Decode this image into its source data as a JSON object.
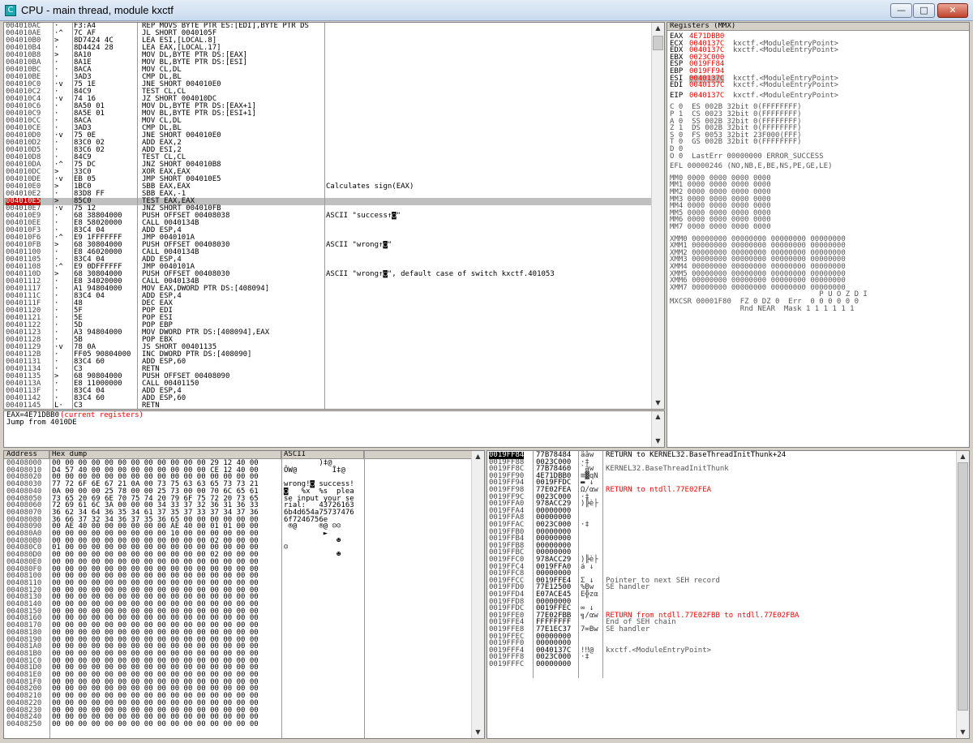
{
  "window": {
    "title": "CPU - main thread, module kxctf",
    "icon_letter": "C",
    "min": "—",
    "max": "□",
    "close": "✕"
  },
  "disasm": {
    "rows": [
      [
        "004010AC",
        "·",
        "F3:A4",
        "REP MOVS BYTE PTR ES:[EDI],BYTE PTR DS",
        ""
      ],
      [
        "004010AE",
        "·^",
        "7C AF",
        "JL SHORT 0040105F",
        ""
      ],
      [
        "004010B0",
        ">",
        "8D7424 4C",
        "LEA ESI,[LOCAL.8]",
        ""
      ],
      [
        "004010B4",
        "·",
        "8D4424 28",
        "LEA EAX,[LOCAL.17]",
        ""
      ],
      [
        "004010B8",
        ">",
        "8A10",
        "MOV DL,BYTE PTR DS:[EAX]",
        ""
      ],
      [
        "004010BA",
        "·",
        "8A1E",
        "MOV BL,BYTE PTR DS:[ESI]",
        ""
      ],
      [
        "004010BC",
        "·",
        "8ACA",
        "MOV CL,DL",
        ""
      ],
      [
        "004010BE",
        "·",
        "3AD3",
        "CMP DL,BL",
        ""
      ],
      [
        "004010C0",
        "·v",
        "75 1E",
        "JNE SHORT 004010E0",
        ""
      ],
      [
        "004010C2",
        "·",
        "84C9",
        "TEST CL,CL",
        ""
      ],
      [
        "004010C4",
        "·v",
        "74 16",
        "JZ SHORT 004010DC",
        ""
      ],
      [
        "004010C6",
        "·",
        "8A50 01",
        "MOV DL,BYTE PTR DS:[EAX+1]",
        ""
      ],
      [
        "004010C9",
        "·",
        "8A5E 01",
        "MOV BL,BYTE PTR DS:[ESI+1]",
        ""
      ],
      [
        "004010CC",
        "·",
        "8ACA",
        "MOV CL,DL",
        ""
      ],
      [
        "004010CE",
        "·",
        "3AD3",
        "CMP DL,BL",
        ""
      ],
      [
        "004010D0",
        "·v",
        "75 0E",
        "JNE SHORT 004010E0",
        ""
      ],
      [
        "004010D2",
        "·",
        "83C0 02",
        "ADD EAX,2",
        ""
      ],
      [
        "004010D5",
        "·",
        "83C6 02",
        "ADD ESI,2",
        ""
      ],
      [
        "004010D8",
        "·",
        "84C9",
        "TEST CL,CL",
        ""
      ],
      [
        "004010DA",
        "·^",
        "75 DC",
        "JNZ SHORT 004010B8",
        ""
      ],
      [
        "004010DC",
        ">",
        "33C0",
        "XOR EAX,EAX",
        ""
      ],
      [
        "004010DE",
        "·v",
        "EB 05",
        "JMP SHORT 004010E5",
        ""
      ],
      [
        "004010E0",
        ">",
        "1BC0",
        "SBB EAX,EAX",
        "Calculates sign(EAX)"
      ],
      [
        "004010E2",
        "·",
        "83D8 FF",
        "SBB EAX,-1",
        ""
      ],
      [
        "004010E5",
        ">",
        "85C0",
        "TEST EAX,EAX",
        ""
      ],
      [
        "004010E7",
        "·v",
        "75 12",
        "JNZ SHORT 004010FB",
        ""
      ],
      [
        "004010E9",
        "·",
        "68 38804000",
        "PUSH OFFSET 00408038",
        "ASCII \"success↑◙\""
      ],
      [
        "004010EE",
        "·",
        "E8 58020000",
        "CALL 0040134B",
        ""
      ],
      [
        "004010F3",
        "·",
        "83C4 04",
        "ADD ESP,4",
        ""
      ],
      [
        "004010F6",
        "·^",
        "E9 1FFFFFFF",
        "JMP 0040101A",
        ""
      ],
      [
        "004010FB",
        ">",
        "68 30804000",
        "PUSH OFFSET 00408030",
        "ASCII \"wrong↑◙\""
      ],
      [
        "00401100",
        "·",
        "E8 46020000",
        "CALL 0040134B",
        ""
      ],
      [
        "00401105",
        "·",
        "83C4 04",
        "ADD ESP,4",
        ""
      ],
      [
        "00401108",
        "·^",
        "E9 0DFFFFFF",
        "JMP 0040101A",
        ""
      ],
      [
        "0040110D",
        ">",
        "68 30804000",
        "PUSH OFFSET 00408030",
        "ASCII \"wrong↑◙\", default case of switch kxctf.401053"
      ],
      [
        "00401112",
        "·",
        "E8 34020000",
        "CALL 0040134B",
        ""
      ],
      [
        "00401117",
        "·",
        "A1 94804000",
        "MOV EAX,DWORD PTR DS:[408094]",
        ""
      ],
      [
        "0040111C",
        "·",
        "83C4 04",
        "ADD ESP,4",
        ""
      ],
      [
        "0040111F",
        "·",
        "48",
        "DEC EAX",
        ""
      ],
      [
        "00401120",
        "·",
        "5F",
        "POP EDI",
        ""
      ],
      [
        "00401121",
        "·",
        "5E",
        "POP ESI",
        ""
      ],
      [
        "00401122",
        "·",
        "5D",
        "POP EBP",
        ""
      ],
      [
        "00401123",
        "·",
        "A3 94804000",
        "MOV DWORD PTR DS:[408094],EAX",
        ""
      ],
      [
        "00401128",
        "·",
        "5B",
        "POP EBX",
        ""
      ],
      [
        "00401129",
        "·v",
        "78 0A",
        "JS SHORT 00401135",
        ""
      ],
      [
        "0040112B",
        "·",
        "FF05 90804000",
        "INC DWORD PTR DS:[408090]",
        ""
      ],
      [
        "00401131",
        "·",
        "83C4 60",
        "ADD ESP,60",
        ""
      ],
      [
        "00401134",
        "·",
        "C3",
        "RETN",
        ""
      ],
      [
        "00401135",
        ">",
        "68 90804000",
        "PUSH OFFSET 00408090",
        ""
      ],
      [
        "0040113A",
        "·",
        "E8 11000000",
        "CALL 00401150",
        ""
      ],
      [
        "0040113F",
        "·",
        "83C4 04",
        "ADD ESP,4",
        ""
      ],
      [
        "00401142",
        "·",
        "83C4 60",
        "ADD ESP,60",
        ""
      ],
      [
        "00401145",
        "L·",
        "C3",
        "RETN",
        ""
      ]
    ],
    "current_index": 24,
    "info_line1": "EAX=4E71DBB0",
    "info_line1_note": "(current registers)",
    "info_line2": "Jump from 4010DE"
  },
  "registers": {
    "title": "Registers (MMX)",
    "lines": [
      [
        "EAX",
        "4E71DBB0",
        ""
      ],
      [
        "ECX",
        "0040137C",
        "kxctf.<ModuleEntryPoint>"
      ],
      [
        "EDX",
        "0040137C",
        "kxctf.<ModuleEntryPoint>"
      ],
      [
        "EBX",
        "0023C000",
        ""
      ],
      [
        "ESP",
        "0019FF84",
        ""
      ],
      [
        "EBP",
        "0019FF94",
        ""
      ],
      [
        "ESI",
        "0040137C",
        "kxctf.<ModuleEntryPoint>"
      ],
      [
        "EDI",
        "0040137C",
        "kxctf.<ModuleEntryPoint>"
      ]
    ],
    "eip": [
      "EIP",
      "0040137C",
      "kxctf.<ModuleEntryPoint>"
    ],
    "flags": [
      "C 0  ES 002B 32bit 0(FFFFFFFF)",
      "P 1  CS 0023 32bit 0(FFFFFFFF)",
      "A 0  SS 002B 32bit 0(FFFFFFFF)",
      "Z 1  DS 002B 32bit 0(FFFFFFFF)",
      "S 0  FS 0053 32bit 23F000(FFF)",
      "T 0  GS 002B 32bit 0(FFFFFFFF)",
      "D 0",
      "O 0  LastErr 00000000 ERROR_SUCCESS"
    ],
    "efl": "EFL 00000246 (NO,NB,E,BE,NS,PE,GE,LE)",
    "mm": [
      "MM0 0000 0000 0000 0000",
      "MM1 0000 0000 0000 0000",
      "MM2 0000 0000 0000 0000",
      "MM3 0000 0000 0000 0000",
      "MM4 0000 0000 0000 0000",
      "MM5 0000 0000 0000 0000",
      "MM6 0000 0000 0000 0000",
      "MM7 0000 0000 0000 0000"
    ],
    "xmm": [
      "XMM0 00000000 00000000 00000000 00000000",
      "XMM1 00000000 00000000 00000000 00000000",
      "XMM2 00000000 00000000 00000000 00000000",
      "XMM3 00000000 00000000 00000000 00000000",
      "XMM4 00000000 00000000 00000000 00000000",
      "XMM5 00000000 00000000 00000000 00000000",
      "XMM6 00000000 00000000 00000000 00000000",
      "XMM7 00000000 00000000 00000000 00000000"
    ],
    "mxcsr_hdr": "                                  P U O Z D I",
    "mxcsr": "MXCSR 00001F80  FZ 0 DZ 0  Err  0 0 0 0 0 0",
    "mxcsr2": "                Rnd NEAR  Mask 1 1 1 1 1 1"
  },
  "dump": {
    "headers": [
      "Address",
      "Hex dump",
      "ASCII"
    ],
    "rows": [
      [
        "00408000",
        "00 00 00 00 00 00 00 00 00 00 00 00 29 12 40 00",
        "        )‡@"
      ],
      [
        "00408010",
        "D4 57 40 00 00 00 00 00 00 00 00 00 CE 12 40 00",
        "ÔW@        Î‡@"
      ],
      [
        "00408020",
        "00 00 00 00 00 00 00 00 00 00 00 00 00 00 00 00",
        ""
      ],
      [
        "00408030",
        "77 72 6F 6E 67 21 0A 00 73 75 63 63 65 73 73 21",
        "wrong!◙ success!"
      ],
      [
        "00408040",
        "0A 00 00 00 25 78 00 00 25 73 00 00 70 6C 65 61",
        "◙   %x  %s  plea"
      ],
      [
        "00408050",
        "73 65 20 69 6E 70 75 74 20 79 6F 75 72 20 73 65",
        "se input your se"
      ],
      [
        "00408060",
        "72 69 61 6C 3A 00 00 00 34 33 37 32 36 31 36 33",
        "rial:   43726163"
      ],
      [
        "00408070",
        "36 62 34 64 36 35 34 61 37 35 37 33 37 34 37 36",
        "6b4d654a75737476"
      ],
      [
        "00408080",
        "36 66 37 32 34 36 37 35 36 65 00 00 00 00 00 00",
        "6f7246756e"
      ],
      [
        "00408090",
        "00 AE 40 00 00 00 00 00 00 AE 40 00 01 01 00 00",
        " ®@     ®@ ☺☺"
      ],
      [
        "004080A0",
        "00 00 00 00 00 00 00 00 00 10 00 00 00 00 00 00",
        "         ►"
      ],
      [
        "004080B0",
        "00 00 00 00 00 00 00 00 00 00 00 00 02 00 00 00",
        "            ☻"
      ],
      [
        "004080C0",
        "01 00 00 00 00 00 00 00 00 00 00 00 00 00 00 00",
        "☺"
      ],
      [
        "004080D0",
        "00 00 00 00 00 00 00 00 00 00 00 00 02 00 00 00",
        "            ☻"
      ],
      [
        "004080E0",
        "00 00 00 00 00 00 00 00 00 00 00 00 00 00 00 00",
        ""
      ],
      [
        "004080F0",
        "00 00 00 00 00 00 00 00 00 00 00 00 00 00 00 00",
        ""
      ],
      [
        "00408100",
        "00 00 00 00 00 00 00 00 00 00 00 00 00 00 00 00",
        ""
      ],
      [
        "00408110",
        "00 00 00 00 00 00 00 00 00 00 00 00 00 00 00 00",
        ""
      ],
      [
        "00408120",
        "00 00 00 00 00 00 00 00 00 00 00 00 00 00 00 00",
        ""
      ],
      [
        "00408130",
        "00 00 00 00 00 00 00 00 00 00 00 00 00 00 00 00",
        ""
      ],
      [
        "00408140",
        "00 00 00 00 00 00 00 00 00 00 00 00 00 00 00 00",
        ""
      ],
      [
        "00408150",
        "00 00 00 00 00 00 00 00 00 00 00 00 00 00 00 00",
        ""
      ],
      [
        "00408160",
        "00 00 00 00 00 00 00 00 00 00 00 00 00 00 00 00",
        ""
      ],
      [
        "00408170",
        "00 00 00 00 00 00 00 00 00 00 00 00 00 00 00 00",
        ""
      ],
      [
        "00408180",
        "00 00 00 00 00 00 00 00 00 00 00 00 00 00 00 00",
        ""
      ],
      [
        "00408190",
        "00 00 00 00 00 00 00 00 00 00 00 00 00 00 00 00",
        ""
      ],
      [
        "004081A0",
        "00 00 00 00 00 00 00 00 00 00 00 00 00 00 00 00",
        ""
      ],
      [
        "004081B0",
        "00 00 00 00 00 00 00 00 00 00 00 00 00 00 00 00",
        ""
      ],
      [
        "004081C0",
        "00 00 00 00 00 00 00 00 00 00 00 00 00 00 00 00",
        ""
      ],
      [
        "004081D0",
        "00 00 00 00 00 00 00 00 00 00 00 00 00 00 00 00",
        ""
      ],
      [
        "004081E0",
        "00 00 00 00 00 00 00 00 00 00 00 00 00 00 00 00",
        ""
      ],
      [
        "004081F0",
        "00 00 00 00 00 00 00 00 00 00 00 00 00 00 00 00",
        ""
      ],
      [
        "00408200",
        "00 00 00 00 00 00 00 00 00 00 00 00 00 00 00 00",
        ""
      ],
      [
        "00408210",
        "00 00 00 00 00 00 00 00 00 00 00 00 00 00 00 00",
        ""
      ],
      [
        "00408220",
        "00 00 00 00 00 00 00 00 00 00 00 00 00 00 00 00",
        ""
      ],
      [
        "00408230",
        "00 00 00 00 00 00 00 00 00 00 00 00 00 00 00 00",
        ""
      ],
      [
        "00408240",
        "00 00 00 00 00 00 00 00 00 00 00 00 00 00 00 00",
        ""
      ],
      [
        "00408250",
        "00 00 00 00 00 00 00 00 00 00 00 00 00 00 00 00",
        ""
      ]
    ]
  },
  "stack": {
    "rows": [
      [
        "0019FF84",
        "77B78484",
        "äâw",
        "RETURN to KERNEL32.BaseThreadInitThunk+24",
        "black"
      ],
      [
        "0019FF88",
        "0023C000",
        "·‡",
        "",
        " "
      ],
      [
        "0019FF8C",
        "77B78460",
        "`âw",
        "KERNEL32.BaseThreadInitThunk",
        "gray"
      ],
      [
        "0019FF90",
        "4E71DBB0",
        "≡▓qN",
        "",
        ""
      ],
      [
        "0019FF94",
        "0019FFDC",
        "▬ ↓",
        "",
        ""
      ],
      [
        "0019FF98",
        "77E02FEA",
        "Ω/αw",
        "RETURN to ntdll.77E02FEA",
        "red"
      ],
      [
        "0019FF9C",
        "0023C000",
        "·‡",
        "",
        ""
      ],
      [
        "0019FFA0",
        "978ACC29",
        ")╠è├",
        "",
        ""
      ],
      [
        "0019FFA4",
        "00000000",
        "",
        "",
        ""
      ],
      [
        "0019FFA8",
        "00000000",
        "",
        "",
        ""
      ],
      [
        "0019FFAC",
        "0023C000",
        "·‡",
        "",
        ""
      ],
      [
        "0019FFB0",
        "00000000",
        "",
        "",
        ""
      ],
      [
        "0019FFB4",
        "00000000",
        "",
        "",
        ""
      ],
      [
        "0019FFB8",
        "00000000",
        "",
        "",
        ""
      ],
      [
        "0019FFBC",
        "00000000",
        "",
        "",
        ""
      ],
      [
        "0019FFC0",
        "978ACC29",
        ")╠è├",
        "",
        ""
      ],
      [
        "0019FFC4",
        "0019FFA0",
        "á ↓",
        "",
        ""
      ],
      [
        "0019FFC8",
        "00000000",
        "",
        "",
        ""
      ],
      [
        "0019FFCC",
        "0019FFE4",
        "Σ ↓",
        "Pointer to next SEH record",
        "gray"
      ],
      [
        "0019FFD0",
        "77E12500",
        "%Bw",
        "SE handler",
        "gray"
      ],
      [
        "0019FFD4",
        "E07ACE45",
        "E╬zα",
        "",
        ""
      ],
      [
        "0019FFD8",
        "00000000",
        "",
        "",
        ""
      ],
      [
        "0019FFDC",
        "0019FFEC",
        "∞ ↓",
        "",
        ""
      ],
      [
        "0019FFE0",
        "77E02FBB",
        "╗/αw",
        "RETURN from ntdll.77E02FBB to ntdll.77E02FBA",
        "red"
      ],
      [
        "0019FFE4",
        "FFFFFFFF",
        "",
        "End of SEH chain",
        "gray"
      ],
      [
        "0019FFE8",
        "77E1EC37",
        "7∞Bw",
        "SE handler",
        "gray"
      ],
      [
        "0019FFEC",
        "00000000",
        "",
        "",
        ""
      ],
      [
        "0019FFF0",
        "00000000",
        "",
        "",
        ""
      ],
      [
        "0019FFF4",
        "0040137C",
        "!‼@",
        "kxctf.<ModuleEntryPoint>",
        "gray"
      ],
      [
        "0019FFF8",
        "0023C000",
        "·‡",
        "",
        ""
      ],
      [
        "0019FFFC",
        "00000000",
        "",
        "",
        ""
      ]
    ]
  },
  "colors": {
    "current_row_bg": "#c0c0c0",
    "current_addr_bg": "#cc0000",
    "register_changed": "#ff0000",
    "stack_top_bg": "#000000"
  }
}
